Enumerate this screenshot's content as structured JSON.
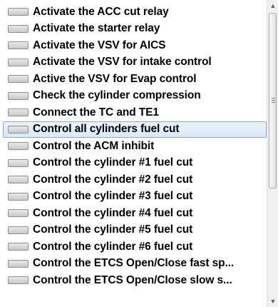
{
  "list": {
    "selected_index": 7,
    "items": [
      {
        "label": "Activate the ACC cut relay"
      },
      {
        "label": "Activate the starter relay"
      },
      {
        "label": "Activate the VSV for AICS"
      },
      {
        "label": "Activate the VSV for intake control"
      },
      {
        "label": "Active the VSV for Evap control"
      },
      {
        "label": "Check the cylinder compression"
      },
      {
        "label": "Connect the TC and TE1"
      },
      {
        "label": "Control all cylinders fuel cut"
      },
      {
        "label": "Control the ACM inhibit"
      },
      {
        "label": "Control the cylinder #1 fuel cut"
      },
      {
        "label": "Control the cylinder #2 fuel cut"
      },
      {
        "label": "Control the cylinder #3 fuel cut"
      },
      {
        "label": "Control the cylinder #4 fuel cut"
      },
      {
        "label": "Control the cylinder #5 fuel cut"
      },
      {
        "label": "Control the cylinder #6 fuel cut"
      },
      {
        "label": "Control the ETCS Open/Close fast sp..."
      },
      {
        "label": "Control the ETCS Open/Close slow s..."
      }
    ]
  },
  "scrollbar": {
    "up_glyph": "▲",
    "down_glyph": "▼"
  }
}
